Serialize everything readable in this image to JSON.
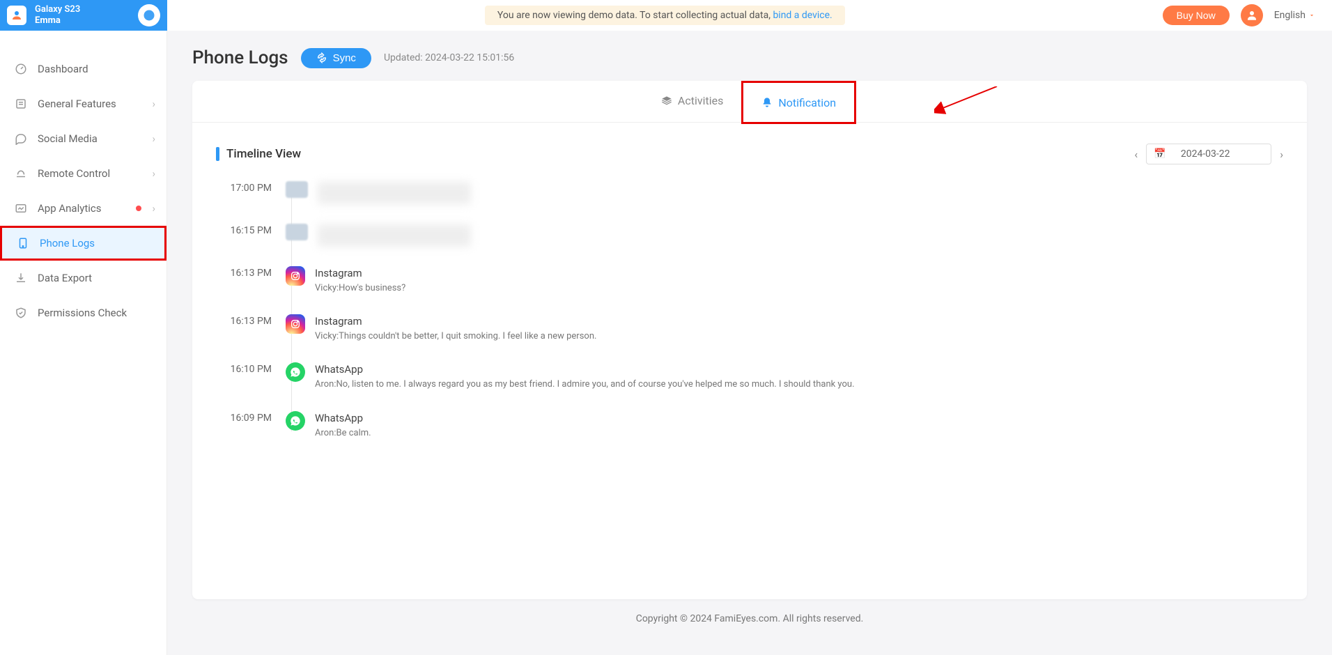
{
  "header": {
    "device_model": "Galaxy S23",
    "device_user": "Emma",
    "banner_prefix": "You are now viewing demo data. To start collecting actual data, ",
    "banner_link": "bind a device.",
    "buy_now": "Buy Now",
    "language": "English"
  },
  "sidebar": {
    "items": [
      {
        "label": "Dashboard"
      },
      {
        "label": "General Features",
        "chev": true
      },
      {
        "label": "Social Media",
        "chev": true
      },
      {
        "label": "Remote Control",
        "chev": true
      },
      {
        "label": "App Analytics",
        "chev": true,
        "dot": true
      },
      {
        "label": "Phone Logs"
      },
      {
        "label": "Data Export"
      },
      {
        "label": "Permissions Check"
      }
    ]
  },
  "page": {
    "title": "Phone Logs",
    "sync": "Sync",
    "updated": "Updated: 2024-03-22 15:01:56"
  },
  "tabs": {
    "activities": "Activities",
    "notification": "Notification"
  },
  "timeline": {
    "title": "Timeline View",
    "date": "2024-03-22",
    "items": [
      {
        "time": "17:00 PM",
        "app": "",
        "msg": "",
        "blur": true
      },
      {
        "time": "16:15 PM",
        "app": "",
        "msg": "",
        "blur": true
      },
      {
        "time": "16:13 PM",
        "app": "Instagram",
        "icon": "instagram",
        "msg": "Vicky:How's business?"
      },
      {
        "time": "16:13 PM",
        "app": "Instagram",
        "icon": "instagram",
        "msg": "Vicky:Things couldn't be better, I quit smoking. I feel like a new person."
      },
      {
        "time": "16:10 PM",
        "app": "WhatsApp",
        "icon": "whatsapp",
        "msg": "Aron:No, listen to me. I always regard you as my best friend. I admire you, and of course you've helped me so much. I should thank you."
      },
      {
        "time": "16:09 PM",
        "app": "WhatsApp",
        "icon": "whatsapp",
        "msg": "Aron:Be calm."
      }
    ]
  },
  "footer": "Copyright © 2024 FamiEyes.com. All rights reserved."
}
